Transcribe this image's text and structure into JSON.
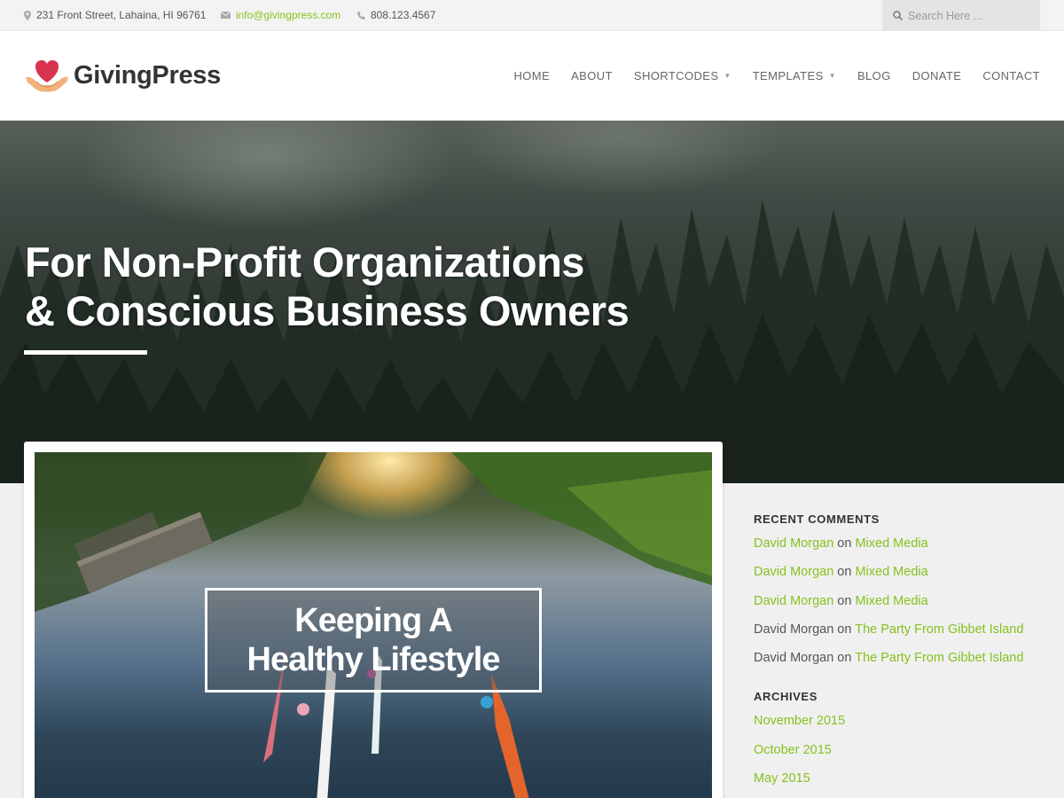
{
  "topbar": {
    "address": "231 Front Street, Lahaina, HI 96761",
    "email": "info@givingpress.com",
    "phone": "808.123.4567",
    "search_placeholder": "Search Here ..."
  },
  "header": {
    "logo_text": "GivingPress",
    "nav": [
      {
        "label": "HOME",
        "dropdown": false
      },
      {
        "label": "ABOUT",
        "dropdown": false
      },
      {
        "label": "SHORTCODES",
        "dropdown": true
      },
      {
        "label": "TEMPLATES",
        "dropdown": true
      },
      {
        "label": "BLOG",
        "dropdown": false
      },
      {
        "label": "DONATE",
        "dropdown": false
      },
      {
        "label": "CONTACT",
        "dropdown": false
      }
    ]
  },
  "hero": {
    "title_line1": "For Non-Profit Organizations",
    "title_line2": "& Conscious Business Owners"
  },
  "post": {
    "title_line1": "Keeping A",
    "title_line2": "Healthy Lifestyle"
  },
  "sidebar": {
    "recent_comments_title": "RECENT COMMENTS",
    "comments": [
      {
        "author": "David Morgan",
        "on": "on",
        "post": "Mixed Media",
        "author_linked": true
      },
      {
        "author": "David Morgan",
        "on": "on",
        "post": "Mixed Media",
        "author_linked": true
      },
      {
        "author": "David Morgan",
        "on": "on",
        "post": "Mixed Media",
        "author_linked": true
      },
      {
        "author": "David Morgan",
        "on": "on",
        "post": "The Party From Gibbet Island",
        "author_linked": false
      },
      {
        "author": "David Morgan",
        "on": "on",
        "post": "The Party From Gibbet Island",
        "author_linked": false
      }
    ],
    "archives_title": "ARCHIVES",
    "archives": [
      "November 2015",
      "October 2015",
      "May 2015"
    ]
  },
  "colors": {
    "accent": "#86c11e",
    "heart": "#d8344f",
    "hand": "#f2b27b"
  }
}
